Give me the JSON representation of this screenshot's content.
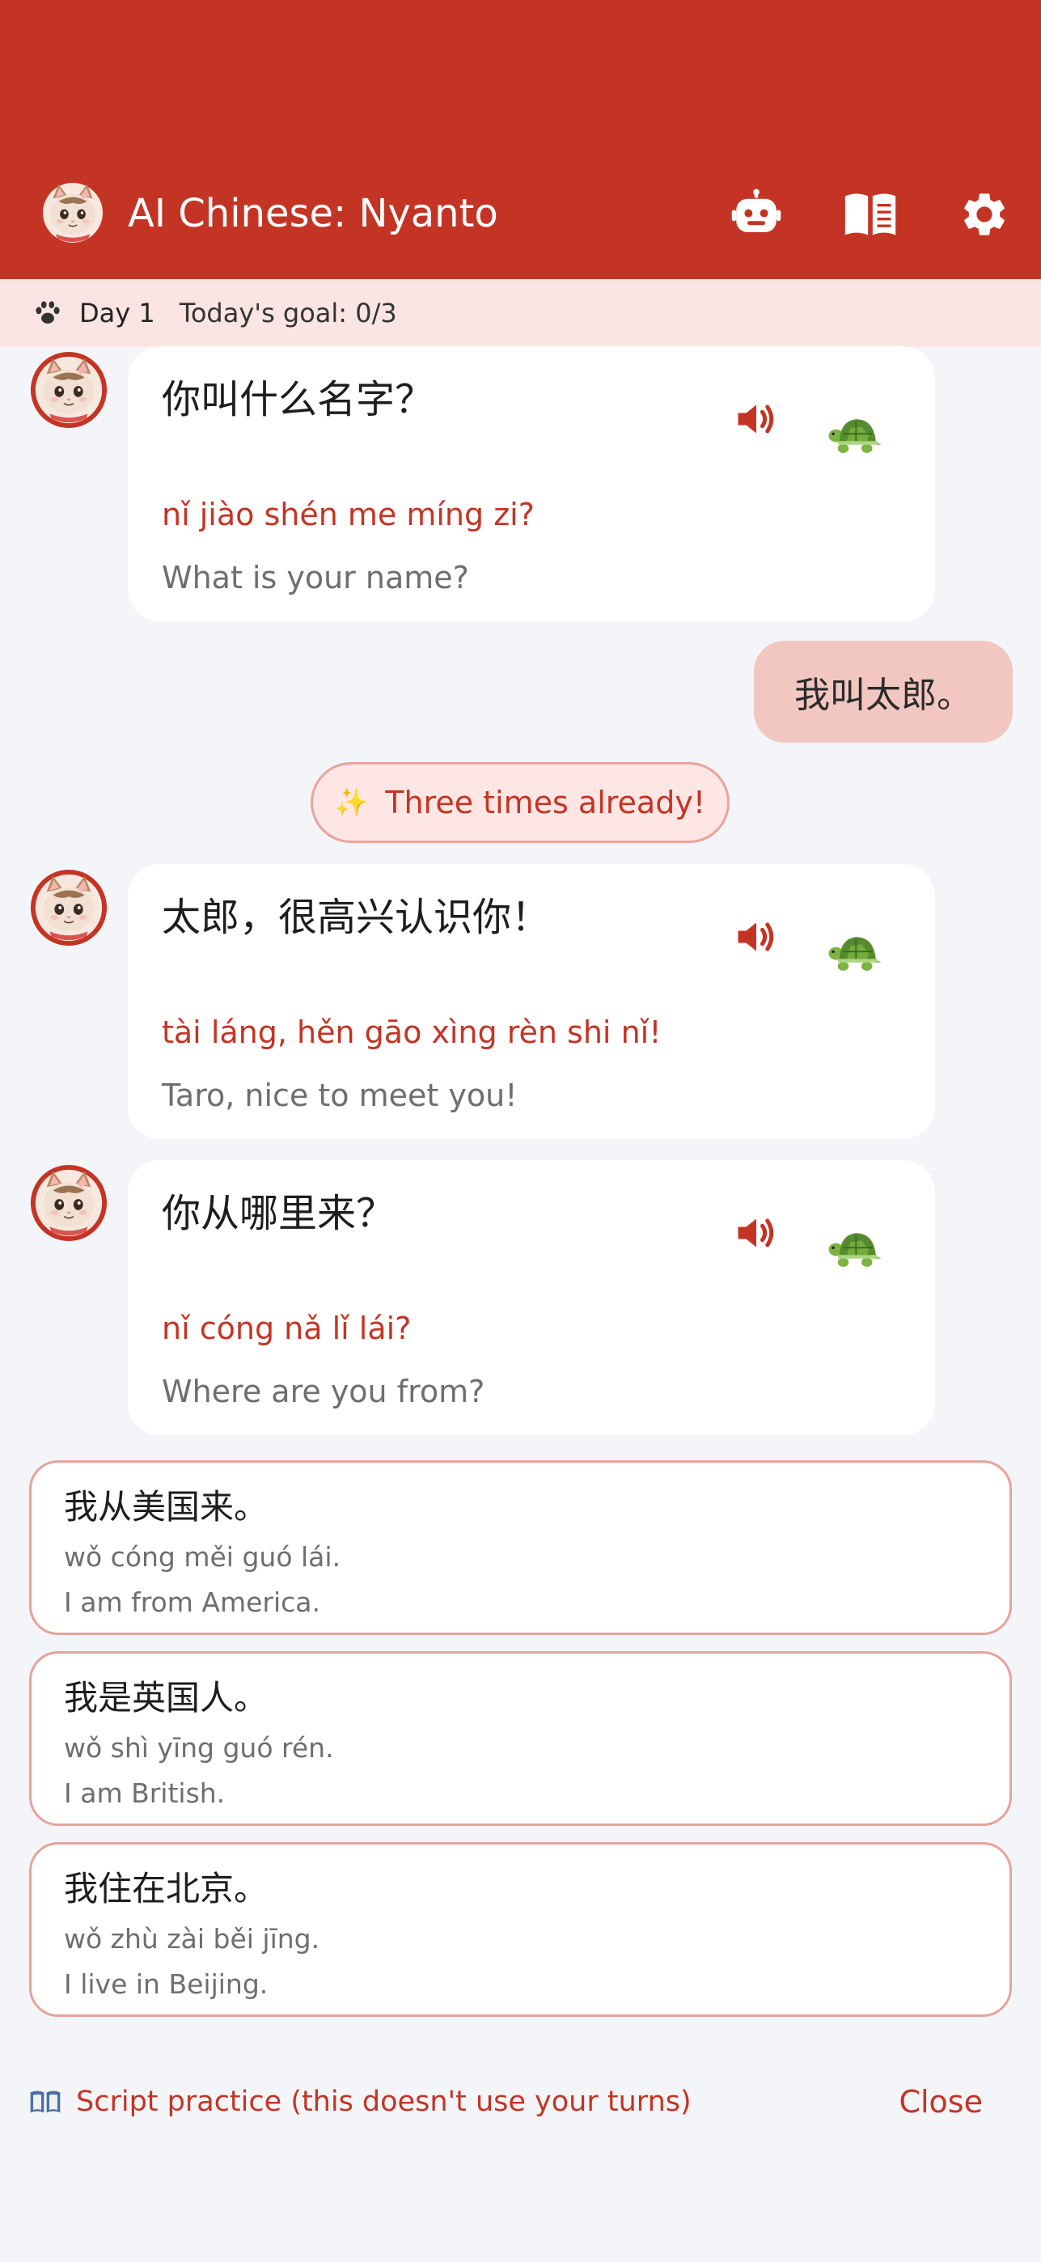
{
  "header": {
    "title": "AI Chinese: Nyanto",
    "icons": [
      "robot-icon",
      "book-icon",
      "gear-icon"
    ],
    "background_color": "#c43424"
  },
  "goal_bar": {
    "day": "Day 1",
    "goal": "Today's goal: 0/3"
  },
  "messages": [
    {
      "hanzi": "你叫什么名字？",
      "pinyin": "nǐ jiào shén me míng zi?",
      "english": "What is your name?"
    },
    {
      "hanzi": "太郎，很高兴认识你！",
      "pinyin": "tài láng, hěn gāo xìng rèn shi nǐ!",
      "english": "Taro, nice to meet you!"
    },
    {
      "hanzi": "你从哪里来？",
      "pinyin": "nǐ cóng nǎ lǐ lái?",
      "english": "Where are you from?"
    }
  ],
  "user_reply": "我叫太郎。",
  "toast": {
    "icon": "sparkles-icon",
    "text": "Three times already!"
  },
  "options": [
    {
      "hanzi": "我从美国来。",
      "pinyin": "wǒ cóng měi guó lái.",
      "english": "I am from America."
    },
    {
      "hanzi": "我是英国人。",
      "pinyin": "wǒ shì yīng guó rén.",
      "english": "I am British."
    },
    {
      "hanzi": "我住在北京。",
      "pinyin": "wǒ zhù zài běi jīng.",
      "english": "I live in Beijing."
    }
  ],
  "footer": {
    "script_practice": "Script practice (this doesn't use your turns)",
    "close": "Close"
  },
  "colors": {
    "accent": "#c43424",
    "user_bubble": "#f3c7c1",
    "background": "#f4f5f9"
  }
}
